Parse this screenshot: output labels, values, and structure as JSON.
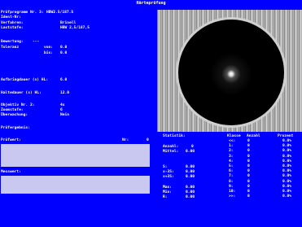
{
  "window": {
    "title": "Härteprüfung"
  },
  "header": {
    "program_label": "Prüfprogramm Nr. 3:",
    "program_value": "HBW2.5/187.5",
    "ident_label": "Ident-Nr:",
    "method_label": "Verfahren:",
    "method_value": "Brinell",
    "load_label": "Laststufe:",
    "load_value": "HBW 2,5/187,5"
  },
  "tolerance": {
    "evaluation_label": "Bewertung:",
    "evaluation_value": "---",
    "tolerance_label": "Toleranz",
    "from_label": "von:",
    "from_value": "0.0",
    "to_label": "bis:",
    "to_value": "0.0"
  },
  "timing": {
    "apply_label": "Aufbringdauer  (s) HL:",
    "apply_value": "6.0",
    "hold_label": "Haltedauer     (s) HL:",
    "hold_value": "12.0"
  },
  "settings": {
    "objective_label": "Objektiv Nr. 2:",
    "objective_value": "4x",
    "zoom_label": "Zoomstufe:",
    "zoom_value": "6",
    "monitoring_label": "Überwachung:",
    "monitoring_value": "Nein"
  },
  "result": {
    "label": "Prüfergebnis:"
  },
  "test_value": {
    "label": "Prüfwert:",
    "nr_label": "Nr:",
    "nr_value": "0"
  },
  "measurement": {
    "label": "Messwert:"
  },
  "statistics": {
    "title": "Statistik:",
    "rows": [
      {
        "label": "Anzahl:",
        "value": "0"
      },
      {
        "label": "Mittel:",
        "value": "0.00"
      },
      {
        "label": "S:",
        "value": "0.00"
      },
      {
        "label": "x-3S:",
        "value": "0.00"
      },
      {
        "label": "x+3S:",
        "value": "0.00"
      },
      {
        "label": "Max:",
        "value": "0.00"
      },
      {
        "label": "Min:",
        "value": "0.00"
      },
      {
        "label": "R:",
        "value": "0.00"
      }
    ]
  },
  "histogram": {
    "columns": {
      "class": "Klasse",
      "count": "Anzahl",
      "percent": "Prozent"
    },
    "rows": [
      {
        "class": "<<:",
        "count": "0",
        "percent": "0.0%"
      },
      {
        "class": "1:",
        "count": "0",
        "percent": "0.0%"
      },
      {
        "class": "2:",
        "count": "0",
        "percent": "0.0%"
      },
      {
        "class": "3:",
        "count": "0",
        "percent": "0.0%"
      },
      {
        "class": "4:",
        "count": "0",
        "percent": "0.0%"
      },
      {
        "class": "5:",
        "count": "0",
        "percent": "0.0%"
      },
      {
        "class": "6:",
        "count": "0",
        "percent": "0.0%"
      },
      {
        "class": "7:",
        "count": "0",
        "percent": "0.0%"
      },
      {
        "class": "8:",
        "count": "0",
        "percent": "0.0%"
      },
      {
        "class": "9:",
        "count": "0",
        "percent": "0.0%"
      },
      {
        "class": "10:",
        "count": "0",
        "percent": "0.0%"
      },
      {
        "class": ">>:",
        "count": "0",
        "percent": "0.0%"
      }
    ]
  },
  "colors": {
    "background": "#0000ff",
    "text": "#ffffff",
    "field": "#c8c8f0",
    "image_dark": "#000000"
  }
}
